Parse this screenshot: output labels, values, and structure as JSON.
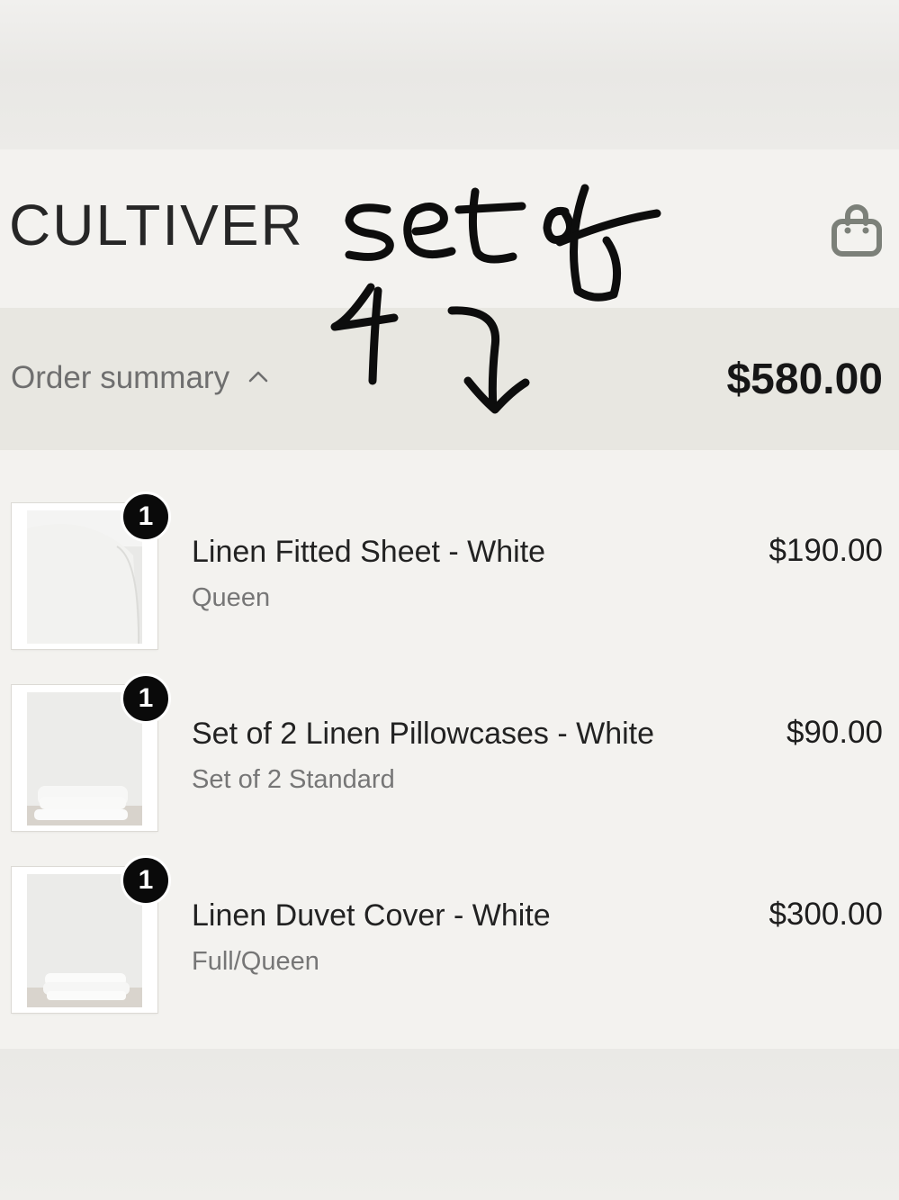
{
  "header": {
    "logo": "CULTIVER",
    "cart_icon": "shopping-bag-icon"
  },
  "summary": {
    "label": "Order summary",
    "toggle_icon": "chevron-up-icon",
    "total": "$580.00"
  },
  "items": [
    {
      "name": "Linen Fitted Sheet - White",
      "variant": "Queen",
      "price": "$190.00",
      "quantity": "1"
    },
    {
      "name": "Set of 2 Linen Pillowcases - White",
      "variant": "Set of 2 Standard",
      "price": "$90.00",
      "quantity": "1"
    },
    {
      "name": "Linen Duvet Cover - White",
      "variant": "Full/Queen",
      "price": "$300.00",
      "quantity": "1"
    }
  ],
  "annotation": {
    "text": "set of 4",
    "icon": "handwritten-arrow-icon"
  }
}
